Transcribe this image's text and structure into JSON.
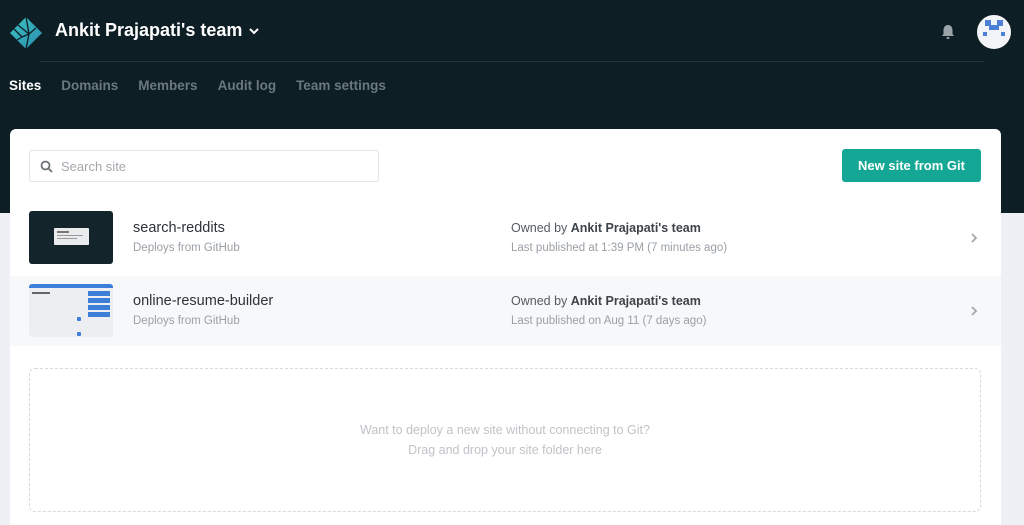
{
  "header": {
    "team_name": "Ankit Prajapati's team",
    "logo_icon": "netlify-logo-icon",
    "notifications_icon": "bell-icon",
    "avatar_icon": "user-avatar"
  },
  "nav": {
    "tabs": [
      {
        "label": "Sites",
        "active": true
      },
      {
        "label": "Domains",
        "active": false
      },
      {
        "label": "Members",
        "active": false
      },
      {
        "label": "Audit log",
        "active": false
      },
      {
        "label": "Team settings",
        "active": false
      }
    ]
  },
  "toolbar": {
    "search_placeholder": "Search site",
    "search_value": "",
    "new_site_label": "New site from Git"
  },
  "sites": [
    {
      "name": "search-reddits",
      "source": "Deploys from GitHub",
      "owner_prefix": "Owned by",
      "owner": "Ankit Prajapati's team",
      "published": "Last published at 1:39 PM (7 minutes ago)"
    },
    {
      "name": "online-resume-builder",
      "source": "Deploys from GitHub",
      "owner_prefix": "Owned by",
      "owner": "Ankit Prajapati's team",
      "published": "Last published on Aug 11 (7 days ago)"
    }
  ],
  "dropzone": {
    "line1": "Want to deploy a new site without connecting to Git?",
    "line2": "Drag and drop your site folder here"
  },
  "colors": {
    "header_bg": "#0e1e25",
    "accent": "#14a795",
    "page_bg": "#eef0f5"
  }
}
